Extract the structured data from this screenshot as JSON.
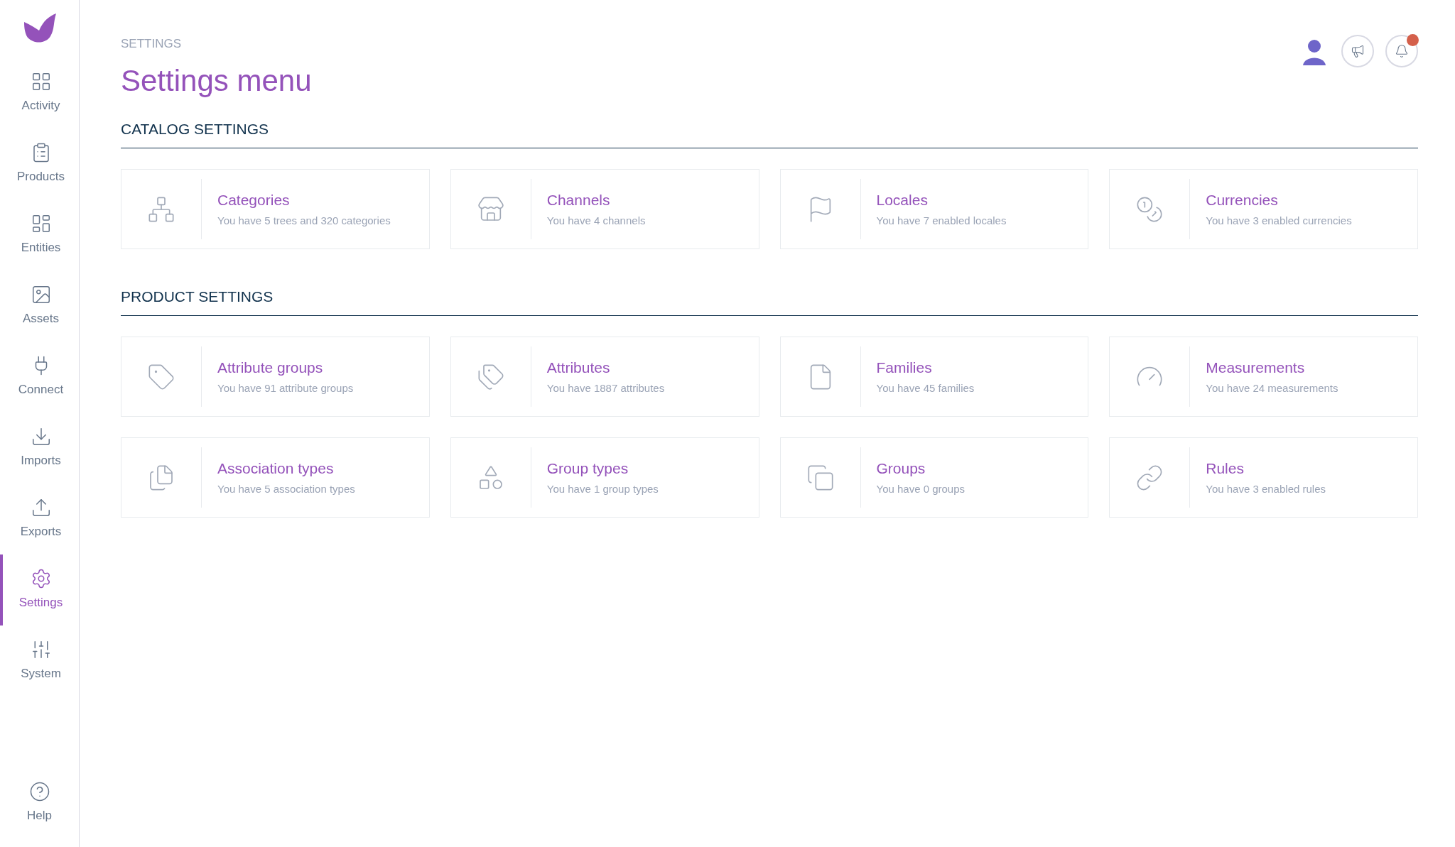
{
  "sidebar": {
    "items": [
      {
        "label": "Activity",
        "selected": false
      },
      {
        "label": "Products",
        "selected": false
      },
      {
        "label": "Entities",
        "selected": false
      },
      {
        "label": "Assets",
        "selected": false
      },
      {
        "label": "Connect",
        "selected": false
      },
      {
        "label": "Imports",
        "selected": false
      },
      {
        "label": "Exports",
        "selected": false
      },
      {
        "label": "Settings",
        "selected": true
      },
      {
        "label": "System",
        "selected": false
      }
    ],
    "help": {
      "label": "Help"
    }
  },
  "header": {
    "breadcrumb": "SETTINGS",
    "title": "Settings menu",
    "notifications": {
      "unread": true
    }
  },
  "sections": [
    {
      "title": "CATALOG SETTINGS",
      "cards": [
        {
          "title": "Categories",
          "description": "You have 5 trees and 320 categories"
        },
        {
          "title": "Channels",
          "description": "You have 4 channels"
        },
        {
          "title": "Locales",
          "description": "You have 7 enabled locales"
        },
        {
          "title": "Currencies",
          "description": "You have 3 enabled currencies"
        }
      ]
    },
    {
      "title": "PRODUCT SETTINGS",
      "cards": [
        {
          "title": "Attribute groups",
          "description": "You have 91 attribute groups"
        },
        {
          "title": "Attributes",
          "description": "You have 1887 attributes"
        },
        {
          "title": "Families",
          "description": "You have 45 families"
        },
        {
          "title": "Measurements",
          "description": "You have 24 measurements"
        },
        {
          "title": "Association types",
          "description": "You have 5 association types"
        },
        {
          "title": "Group types",
          "description": "You have 1 group types"
        },
        {
          "title": "Groups",
          "description": "You have 0 groups"
        },
        {
          "title": "Rules",
          "description": "You have 3 enabled rules"
        }
      ]
    }
  ]
}
